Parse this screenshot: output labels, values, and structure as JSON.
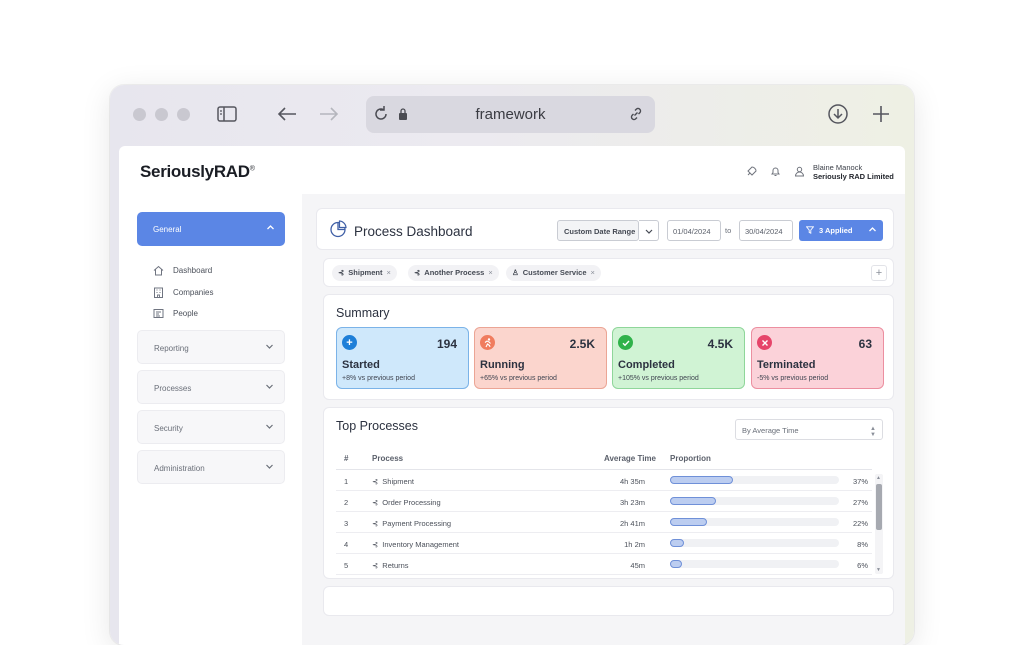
{
  "browser": {
    "url": "framework",
    "icons": [
      "sidebar-icon",
      "back-arrow-icon",
      "forward-arrow-icon",
      "reload-icon",
      "lock-icon",
      "link-icon",
      "download-icon",
      "new-tab-icon"
    ]
  },
  "app": {
    "logo": "SeriouslyRAD",
    "logo_mark": "®",
    "user": {
      "name": "Blaine Manock",
      "org": "Seriously RAD Limited"
    }
  },
  "sidebar": {
    "active": "General",
    "subitems": [
      {
        "label": "Dashboard",
        "icon": "home-icon"
      },
      {
        "label": "Companies",
        "icon": "building-icon"
      },
      {
        "label": "People",
        "icon": "id-card-icon"
      }
    ],
    "sections": [
      "Reporting",
      "Processes",
      "Security",
      "Administration"
    ]
  },
  "dashboard": {
    "title": "Process Dashboard",
    "date_range_label": "Custom Date Range",
    "date_from": "01/04/2024",
    "to_label": "to",
    "date_to": "30/04/2024",
    "filters_applied": "3 Applied",
    "filter_chips": [
      "Shipment",
      "Another Process",
      "Customer Service"
    ]
  },
  "summary": {
    "title": "Summary",
    "stats": [
      {
        "label": "Started",
        "value": "194",
        "change": "+8% vs previous period",
        "color": "#cfe8fb",
        "border": "#7bb3e8",
        "icon_bg": "#1e7fd8",
        "icon": "plus-icon"
      },
      {
        "label": "Running",
        "value": "2.5K",
        "change": "+65% vs previous period",
        "color": "#fbd5cd",
        "border": "#eba595",
        "icon_bg": "#f07c5e",
        "icon": "running-icon"
      },
      {
        "label": "Completed",
        "value": "4.5K",
        "change": "+105% vs previous period",
        "color": "#d0f3d4",
        "border": "#8fd69a",
        "icon_bg": "#2fb24a",
        "icon": "check-icon"
      },
      {
        "label": "Terminated",
        "value": "63",
        "change": "-5% vs previous period",
        "color": "#fbd2d9",
        "border": "#ec8fa0",
        "icon_bg": "#e6456a",
        "icon": "close-icon"
      }
    ]
  },
  "top_processes": {
    "title": "Top Processes",
    "sort_label": "By Average Time",
    "columns": [
      "#",
      "Process",
      "Average Time",
      "Proportion"
    ],
    "rows": [
      {
        "idx": "1",
        "process": "Shipment",
        "time": "4h 35m",
        "pct": "37%",
        "fraction": 0.37
      },
      {
        "idx": "2",
        "process": "Order Processing",
        "time": "3h 23m",
        "pct": "27%",
        "fraction": 0.27
      },
      {
        "idx": "3",
        "process": "Payment Processing",
        "time": "2h 41m",
        "pct": "22%",
        "fraction": 0.22
      },
      {
        "idx": "4",
        "process": "Inventory Management",
        "time": "1h 2m",
        "pct": "8%",
        "fraction": 0.08
      },
      {
        "idx": "5",
        "process": "Returns",
        "time": "45m",
        "pct": "6%",
        "fraction": 0.06
      }
    ]
  }
}
